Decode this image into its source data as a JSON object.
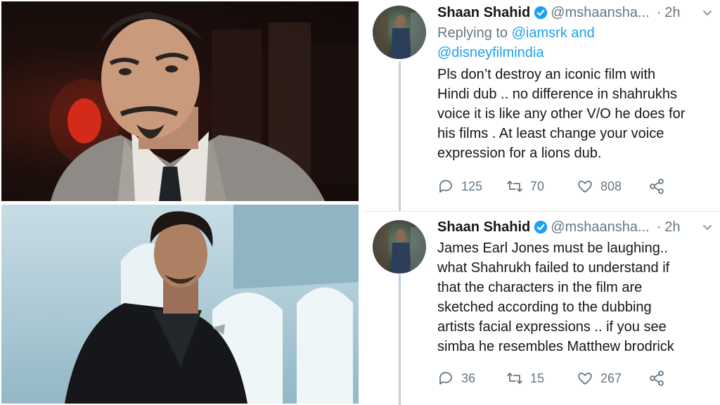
{
  "photos": {
    "top": {
      "subject": "man in grey suit with goatee against dark red background"
    },
    "bottom": {
      "subject": "man in black double-breasted suit against light blue arched wall"
    }
  },
  "tweets": [
    {
      "author_name": "Shaan Shahid",
      "handle": "@mshaansha...",
      "separator": "·",
      "time": "2h",
      "replying_prefix": "Replying to",
      "mention_1": "@iamsrk",
      "mention_and": "and",
      "mention_2": "@disneyfilmindia",
      "lines": [
        "Pls don’t destroy an iconic film with",
        "Hindi dub .. no difference in shahrukhs",
        "voice it is like any other V/O he does for",
        "his films . At least change your voice",
        "expression for a lions dub."
      ],
      "replies": "125",
      "retweets": "70",
      "likes": "808"
    },
    {
      "author_name": "Shaan Shahid",
      "handle": "@mshaansha...",
      "separator": "·",
      "time": "2h",
      "lines": [
        "James Earl Jones must be laughing..",
        "what Shahrukh failed to understand if",
        "that the characters in the film are",
        "sketched according to the dubbing",
        "artists facial expressions .. if you see",
        "simba he resembles Matthew brodrick"
      ],
      "replies": "36",
      "retweets": "15",
      "likes": "267"
    }
  ],
  "icons": {
    "verified": "verified-badge-icon",
    "caret": "chevron-down-icon",
    "reply": "reply-icon",
    "retweet": "retweet-icon",
    "like": "heart-icon",
    "share": "share-icon"
  },
  "colors": {
    "name": "#14171a",
    "muted": "#657786",
    "link": "#1da1f2",
    "thread_line": "#c4cfd6"
  }
}
